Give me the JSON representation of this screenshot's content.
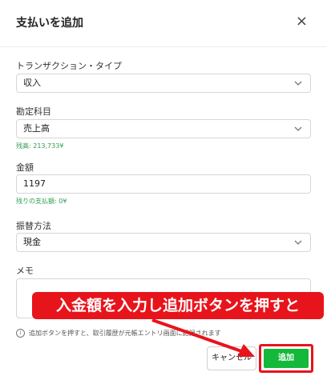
{
  "dialog": {
    "title": "支払いを追加",
    "close_glyph": "×"
  },
  "form": {
    "transaction_type": {
      "label": "トランザクション・タイプ",
      "value": "収入"
    },
    "account": {
      "label": "勘定科目",
      "value": "売上高",
      "help": "残高: 213,733¥"
    },
    "amount": {
      "label": "金額",
      "value": "1197",
      "help": "残りの支払額: 0¥"
    },
    "method": {
      "label": "振替方法",
      "value": "現金"
    },
    "memo": {
      "label": "メモ",
      "value": ""
    }
  },
  "note": {
    "icon": "info-icon",
    "text": "追加ボタンを押すと、取引履歴が元帳エントリ画面に記録されます"
  },
  "buttons": {
    "cancel_label": "キャンセル",
    "add_label": "追加"
  },
  "annotation": {
    "callout_text": "入金額を入力し追加ボタンを押すと",
    "highlight_color": "#e8141b"
  },
  "colors": {
    "accent_green": "#14b83a",
    "help_green": "#2e9d4e",
    "annotation_red": "#e8141b"
  }
}
